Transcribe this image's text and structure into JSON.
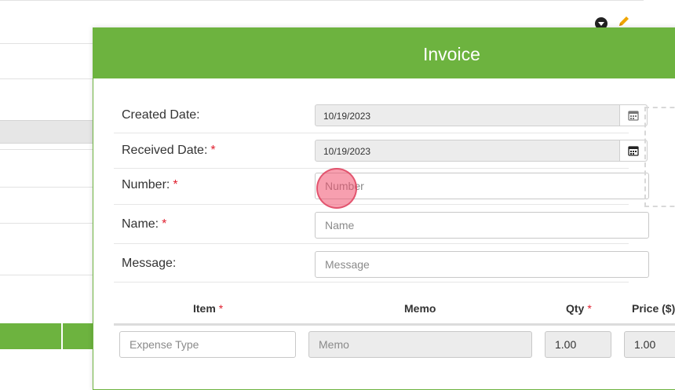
{
  "modal": {
    "title": "Invoice",
    "fields": {
      "created_date": {
        "label": "Created Date:",
        "value": "10/19/2023"
      },
      "received_date": {
        "label": "Received Date:",
        "value": "10/19/2023",
        "required_mark": "*"
      },
      "number": {
        "label": "Number:",
        "placeholder": "Number",
        "required_mark": "*"
      },
      "name": {
        "label": "Name:",
        "placeholder": "Name",
        "required_mark": "*"
      },
      "message": {
        "label": "Message:",
        "placeholder": "Message"
      }
    },
    "table": {
      "headers": {
        "item": "Item",
        "item_required": "*",
        "memo": "Memo",
        "qty": "Qty",
        "qty_required": "*",
        "price": "Price ($)"
      },
      "row": {
        "item_placeholder": "Expense Type",
        "memo_placeholder": "Memo",
        "qty_value": "1.00",
        "price_value": "1.00"
      }
    }
  },
  "colors": {
    "accent": "#6db33f",
    "required": "#e0202f",
    "edit_icon": "#f0a500"
  },
  "icons": [
    "calendar-icon",
    "chevron-down-icon",
    "pencil-icon"
  ]
}
